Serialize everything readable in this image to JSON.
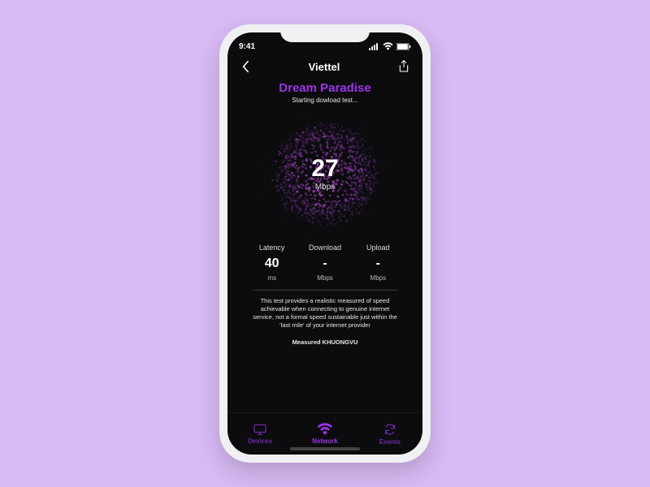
{
  "statusbar": {
    "time": "9:41"
  },
  "navbar": {
    "title": "Viettel"
  },
  "main": {
    "network_name": "Dream Paradise",
    "subtitle": "Starting dowload test...",
    "speed_value": "27",
    "speed_unit": "Mbps"
  },
  "metrics": [
    {
      "label": "Latency",
      "value": "40",
      "unit": "ms"
    },
    {
      "label": "Download",
      "value": "-",
      "unit": "Mbps"
    },
    {
      "label": "Upload",
      "value": "-",
      "unit": "Mbps"
    }
  ],
  "disclaimer": "This test provides a realistic measured of speed achievable when connecting to genuine internet service, not a formal speed sustainable just within the 'last mile' of your internet provider",
  "measured": "Measured KHUONGVU",
  "tabs": [
    {
      "label": "Devices"
    },
    {
      "label": "Network"
    },
    {
      "label": "Events"
    }
  ],
  "colors": {
    "accent": "#9b34e8"
  }
}
